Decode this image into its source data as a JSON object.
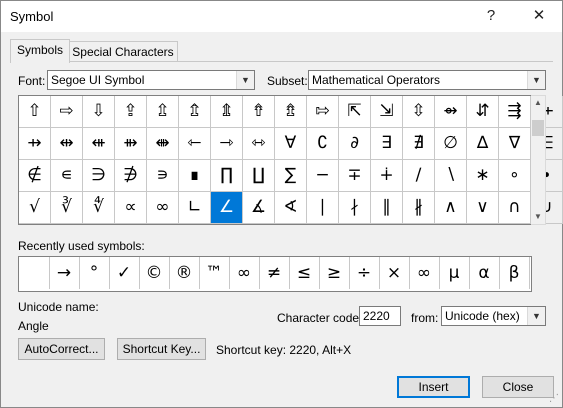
{
  "window": {
    "title": "Symbol",
    "help_label": "?",
    "close_label": "✕"
  },
  "tabs": [
    {
      "label": "Symbols",
      "active": true
    },
    {
      "label": "Special Characters",
      "active": false
    }
  ],
  "font": {
    "label": "Font:",
    "value": "Segoe UI Symbol"
  },
  "subset": {
    "label": "Subset:",
    "value": "Mathematical Operators"
  },
  "symbols": [
    [
      "⇧",
      "⇨",
      "⇩",
      "⇪",
      "⇫",
      "⇬",
      "⇭",
      "⇮",
      "⇯",
      "⇰",
      "⇱",
      "⇲",
      "⇳",
      "⇴",
      "⇵",
      "⇶",
      "⇷"
    ],
    [
      "⇸",
      "⇹",
      "⇺",
      "⇻",
      "⇼",
      "⇽",
      "⇾",
      "⇿",
      "∀",
      "∁",
      "∂",
      "∃",
      "∄",
      "∅",
      "∆",
      "∇",
      "∈"
    ],
    [
      "∉",
      "∊",
      "∋",
      "∌",
      "∍",
      "∎",
      "∏",
      "∐",
      "∑",
      "−",
      "∓",
      "∔",
      "∕",
      "∖",
      "∗",
      "∘",
      "∙"
    ],
    [
      "√",
      "∛",
      "∜",
      "∝",
      "∞",
      "∟",
      "∠",
      "∡",
      "∢",
      "∣",
      "∤",
      "∥",
      "∦",
      "∧",
      "∨",
      "∩",
      "∪"
    ]
  ],
  "selected_symbol": "∠",
  "recent": {
    "label": "Recently used symbols:",
    "items": [
      " ",
      "→",
      "°",
      "✓",
      "©",
      "®",
      "™",
      "∞",
      "≠",
      "≤",
      "≥",
      "÷",
      "×",
      "∞",
      "µ",
      "α",
      "β"
    ]
  },
  "unicode": {
    "label": "Unicode name:",
    "name": "Angle"
  },
  "charcode": {
    "label": "Character code:",
    "value": "2220"
  },
  "from": {
    "label": "from:",
    "value": "Unicode (hex)"
  },
  "buttons": {
    "autocorrect": "AutoCorrect...",
    "shortcut_key": "Shortcut Key...",
    "insert": "Insert",
    "close": "Close"
  },
  "shortcut_text": "Shortcut key: 2220, Alt+X"
}
